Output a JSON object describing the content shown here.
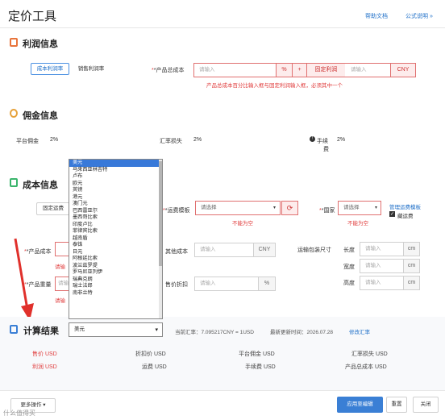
{
  "header": {
    "title": "定价工具",
    "help_link": "帮助文档",
    "formula_link": "公式说明 »"
  },
  "profit": {
    "title": "利润信息",
    "tab_cost_rate": "成本利润率",
    "tab_sales_rate": "销售利润率",
    "total_cost_label": "*产品总成本",
    "placeholder": "请输入",
    "percent": "%",
    "plus": "+",
    "fixed_profit": "固定利润",
    "currency": "CNY",
    "error": "产品总成本百分比输入框与固定利润输入框，必须其中一个"
  },
  "commission": {
    "title": "佣金信息",
    "platform_label": "平台佣金",
    "platform_value": "2%",
    "fx_loss_label": "汇率损失",
    "fx_loss_value": "2%",
    "fee_label_1": "手续",
    "fee_label_2": "费",
    "fee_value": "2%"
  },
  "cost": {
    "title": "成本信息",
    "fixed_shipping": "固定运费",
    "shipping_template_label": "*运费模板",
    "select_placeholder": "请选择",
    "not_empty": "不能为空",
    "country_label": "*国家",
    "manage_template_link": "管理运费模板",
    "include_freight_label": "藏运费",
    "product_cost_label": "*产品成本",
    "product_weight_label": "*产品重量",
    "input_placeholder_cut": "请输",
    "error_cut": "请输",
    "other_cost_label": "其他成本",
    "other_cost_currency": "CNY",
    "discount_label": "售价折扣",
    "discount_unit": "%",
    "package_size_label": "运输包装尺寸",
    "length_label": "长度",
    "width_label": "宽度",
    "height_label": "高度",
    "unit_cm": "cm",
    "placeholder": "请输入"
  },
  "currency_dropdown": {
    "options": [
      "美元",
      "马来西亚林吉特",
      "卢布",
      "欧元",
      "英镑",
      "港元",
      "澳门元",
      "巴西雷亚尔",
      "墨西哥比索",
      "印度卢比",
      "菲律宾比索",
      "越南盾",
      "泰铢",
      "日元",
      "阿根廷比索",
      "波兰兹罗提",
      "罗马尼亚列伊",
      "瑞典克朗",
      "瑞士法郎",
      "南非兰特"
    ],
    "selected_index": 0
  },
  "result": {
    "title": "计算结果",
    "currency_selected": "美元",
    "rate_text": "当前汇率：7.095217CNY = 1USD",
    "updated_text": "最新更新时间：2026.07.28",
    "update_link": "修改汇率",
    "row1": [
      "售价 USD",
      "折扣价 USD",
      "平台佣金 USD",
      "汇率损失 USD"
    ],
    "row2": [
      "利润 USD",
      "运费 USD",
      "手续费 USD",
      "产品总成本 USD"
    ]
  },
  "footer": {
    "more_actions": "更多操作 ▾",
    "apply_button": "应用至编辑",
    "reset_button": "重置",
    "close_button": "关闭",
    "watermark": "什么值得买"
  },
  "colors": {
    "accent": "#3a7fd5",
    "error": "#e03c3c",
    "section_icon_profit": "#e8743b",
    "section_icon_commission": "#e6a23c",
    "section_icon_cost": "#3ab56c",
    "section_icon_result": "#3a7fd5"
  }
}
